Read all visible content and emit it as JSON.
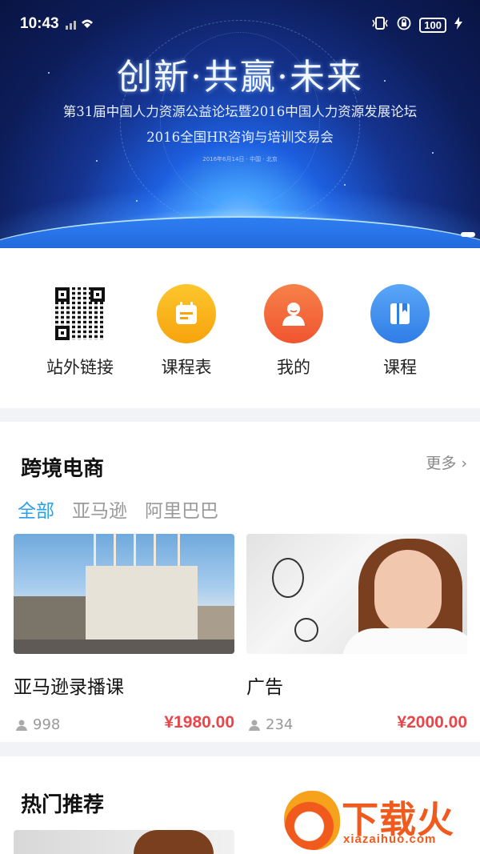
{
  "status_bar": {
    "time": "10:43",
    "battery": "100"
  },
  "banner": {
    "title": "创新·共赢·未来",
    "subtitle_line1": "第31届中国人力资源公益论坛暨2016中国人力资源发展论坛",
    "subtitle_line2": "2016全国HR咨询与培训交易会",
    "subtitle_line3": "2016年6月14日 · 中国 · 北京"
  },
  "quick_nav": [
    {
      "label": "站外链接",
      "icon": "qr-code-icon"
    },
    {
      "label": "课程表",
      "icon": "schedule-icon",
      "color": "#fbb313"
    },
    {
      "label": "我的",
      "icon": "user-icon",
      "color": "#f5683f"
    },
    {
      "label": "课程",
      "icon": "book-icon",
      "color": "#3d8ef0"
    }
  ],
  "section_cross_border": {
    "title": "跨境电商",
    "more": "更多",
    "tabs": [
      "全部",
      "亚马逊",
      "阿里巴巴"
    ],
    "active_tab": "全部",
    "cards": [
      {
        "name": "亚马逊录播课",
        "views": "998",
        "price": "¥1980.00"
      },
      {
        "name": "广告",
        "views": "234",
        "price": "¥2000.00"
      }
    ]
  },
  "section_hot": {
    "title": "热门推荐"
  },
  "watermark": {
    "cn": "下载火",
    "en": "xiazaihuo.com"
  },
  "colors": {
    "accent_tab": "#2aa0e8",
    "price": "#e8464b"
  }
}
